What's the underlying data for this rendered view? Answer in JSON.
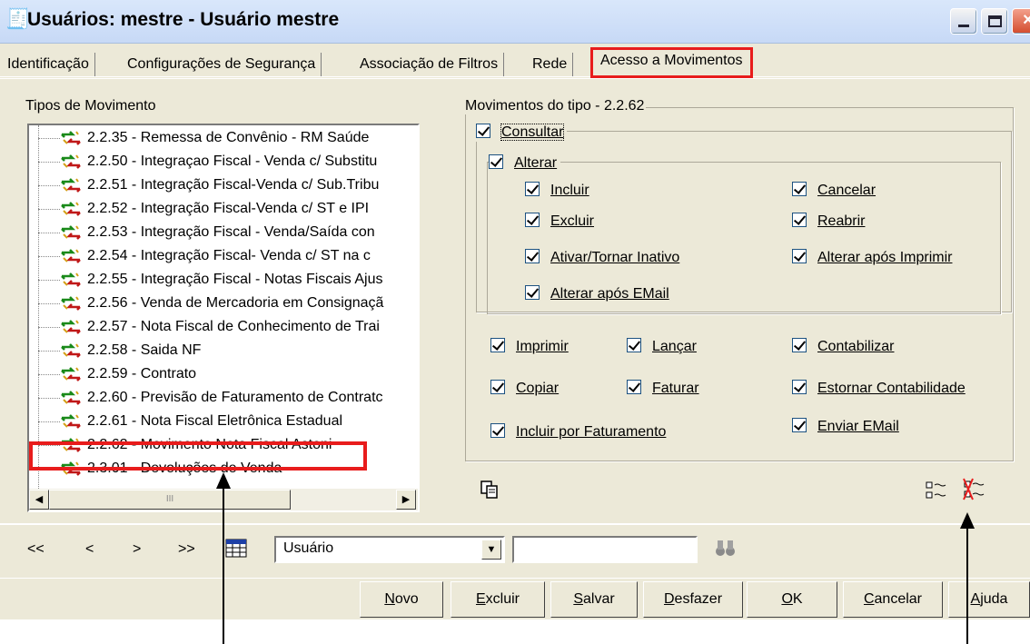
{
  "window": {
    "title": "Usuários: mestre - Usuário mestre"
  },
  "tabs": [
    {
      "label": "Identificação"
    },
    {
      "label": "Configurações de Segurança"
    },
    {
      "label": "Associação de Filtros"
    },
    {
      "label": "Rede"
    },
    {
      "label": "Acesso a Movimentos",
      "active": true
    }
  ],
  "tree": {
    "label": "Tipos de Movimento",
    "items": [
      {
        "label": "2.2.35 - Remessa de Convênio  -  RM Saúde"
      },
      {
        "label": "2.2.50 - Integraçao Fiscal - Venda c/ Substitu"
      },
      {
        "label": "2.2.51 - Integração Fiscal-Venda c/ Sub.Tribu"
      },
      {
        "label": "2.2.52 - Integração Fiscal-Venda c/ ST e IPI"
      },
      {
        "label": "2.2.53 - Integração Fiscal - Venda/Saída con"
      },
      {
        "label": "2.2.54 - Integração Fiscal- Venda c/ ST na c"
      },
      {
        "label": "2.2.55 - Integração Fiscal - Notas Fiscais Ajus"
      },
      {
        "label": "2.2.56 - Venda de Mercadoria em Consignaçã"
      },
      {
        "label": "2.2.57 - Nota Fiscal de Conhecimento de Trai"
      },
      {
        "label": "2.2.58 - Saida NF"
      },
      {
        "label": "2.2.59 - Contrato"
      },
      {
        "label": "2.2.60 - Previsão de Faturamento de Contratc"
      },
      {
        "label": "2.2.61 - Nota Fiscal Eletrônica Estadual"
      },
      {
        "label": "2.2.62 - Movimento Nota Fiscal Astoni",
        "selected": true
      },
      {
        "label": "2.3.01 - Devoluções de Venda"
      }
    ],
    "scroll_thumb_glyph": "III"
  },
  "movimentos": {
    "label": "Movimentos do tipo - 2.2.62",
    "consultar": "Consultar",
    "alterar": "Alterar",
    "incluir": "Incluir",
    "cancelar": "Cancelar",
    "excluir": "Excluir",
    "reabrir": "Reabrir",
    "ativar": "Ativar/Tornar Inativo",
    "alterar_apos_imprimir": "Alterar após Imprimir",
    "alterar_apos_email": "Alterar após EMail",
    "imprimir": "Imprimir",
    "lancar": "Lançar",
    "contabilizar": "Contabilizar",
    "copiar": "Copiar",
    "faturar": "Faturar",
    "estornar": "Estornar Contabilidade",
    "incluir_faturamento": "Incluir por Faturamento",
    "enviar_email": "Enviar  EMail"
  },
  "navigation": {
    "first": "<<",
    "prev": "<",
    "next": ">",
    "last": ">>",
    "field_value": "Usuário",
    "search_value": ""
  },
  "buttons": [
    {
      "label": "Novo",
      "key": "N",
      "rest": "ovo"
    },
    {
      "label": "Excluir",
      "key": "E",
      "rest": "xcluir"
    },
    {
      "label": "Salvar",
      "key": "S",
      "rest": "alvar"
    },
    {
      "label": "Desfazer",
      "key": "D",
      "rest": "esfazer"
    },
    {
      "label": "OK",
      "key": "O",
      "rest": "K"
    },
    {
      "label": "Cancelar",
      "key": "C",
      "rest": "ancelar"
    },
    {
      "label": "Ajuda",
      "key": "A",
      "rest": "juda"
    }
  ],
  "colors": {
    "highlight": "#e81c1c",
    "face": "#ece9d8",
    "titlebar": "#c7d9f6"
  }
}
